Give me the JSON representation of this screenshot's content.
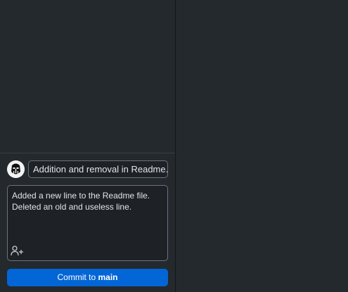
{
  "commit": {
    "summary": "Addition and removal in Readme.",
    "description_lines": [
      "Added a new line to the Readme file.",
      "Deleted an old and useless line."
    ],
    "button_prefix": "Commit to ",
    "branch": "main"
  },
  "icons": {
    "avatar": "user-avatar-icon",
    "coauthor": "add-coauthor-icon"
  },
  "colors": {
    "background": "#24292e",
    "input_bg": "#1e2227",
    "input_border": "#6a737d",
    "text": "#e1e4e8",
    "button": "#0366d6"
  }
}
